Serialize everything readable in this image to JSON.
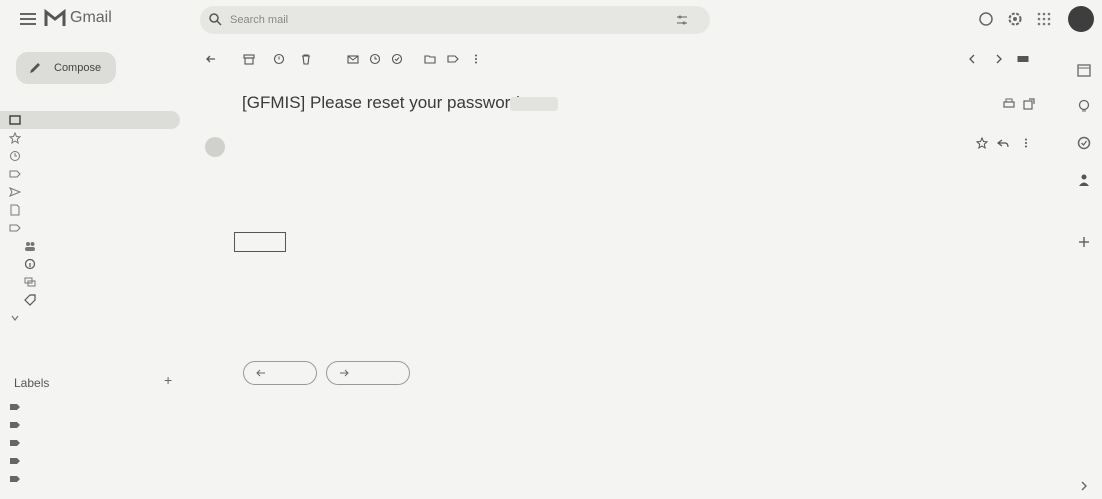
{
  "app": {
    "name": "Gmail",
    "search_placeholder": "Search mail"
  },
  "compose": {
    "label": "Compose"
  },
  "nav": [
    {
      "label": "",
      "icon": "inbox-icon",
      "active": true
    },
    {
      "label": "",
      "icon": "star-icon"
    },
    {
      "label": "",
      "icon": "clock-icon"
    },
    {
      "label": "",
      "icon": "label-icon"
    },
    {
      "label": "",
      "icon": "send-icon"
    },
    {
      "label": "",
      "icon": "file-icon"
    },
    {
      "label": "",
      "icon": "chevron-label-icon"
    },
    {
      "label": "",
      "icon": "people-icon",
      "sub": true
    },
    {
      "label": "",
      "icon": "info-icon",
      "sub": true,
      "bold": true
    },
    {
      "label": "",
      "icon": "forum-icon",
      "sub": true
    },
    {
      "label": "",
      "icon": "tag-icon",
      "sub": true,
      "bold": true
    },
    {
      "label": "",
      "icon": "chevron-down-icon"
    }
  ],
  "labels": {
    "heading": "Labels",
    "items": [
      {
        "label": ""
      },
      {
        "label": ""
      },
      {
        "label": ""
      },
      {
        "label": ""
      },
      {
        "label": ""
      }
    ]
  },
  "email": {
    "subject": "[GFMIS] Please reset your password",
    "sender": "",
    "to": "",
    "body_lines": [
      "",
      "",
      "",
      "",
      "",
      ""
    ],
    "link_label": ""
  },
  "actions": {
    "reply": "",
    "forward": ""
  }
}
